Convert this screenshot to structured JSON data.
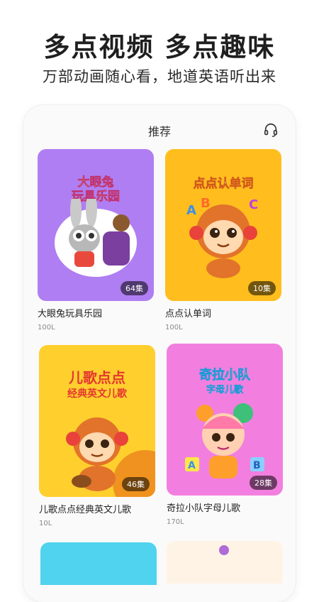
{
  "header": {
    "headline": "多点视频  多点趣味",
    "subheadline": "万部动画随心看，地道英语听出来"
  },
  "screen": {
    "title": "推荐",
    "support_icon": "headset-icon"
  },
  "cards": [
    {
      "art_line1": "大眼兔",
      "art_line2": "玩具乐园",
      "badge": "64集",
      "title": "大眼兔玩具乐园",
      "sub": "100L",
      "color": "#b07ef3"
    },
    {
      "art_line1": "点点认单词",
      "art_line2": "",
      "badge": "10集",
      "title": "点点认单词",
      "sub": "100L",
      "color": "#ffbe1e"
    },
    {
      "art_line1": "儿歌点点",
      "art_line2": "经典英文儿歌",
      "badge": "46集",
      "title": "儿歌点点经典英文儿歌",
      "sub": "10L",
      "color": "#ffcf2e"
    },
    {
      "art_line1": "奇拉小队",
      "art_line2": "字母儿歌",
      "badge": "28集",
      "title": "奇拉小队字母儿歌",
      "sub": "170L",
      "color": "#f27fdf"
    }
  ]
}
